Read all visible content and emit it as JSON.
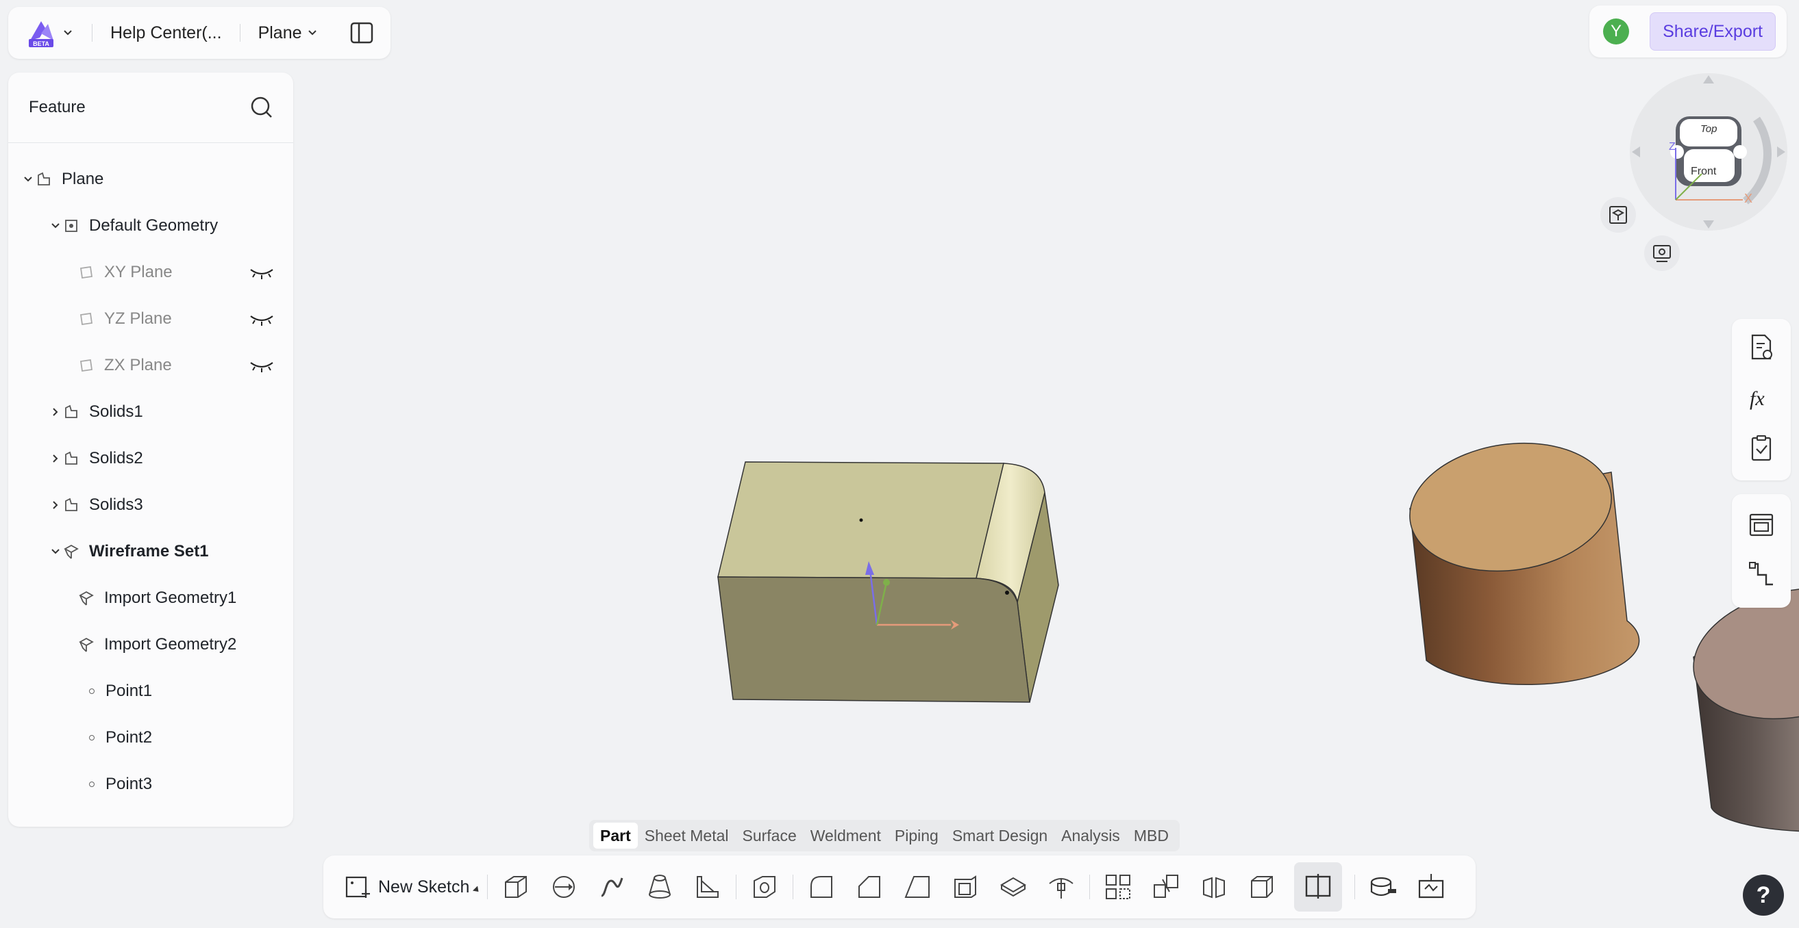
{
  "header": {
    "breadcrumb": "Help Center(...",
    "document": "Plane"
  },
  "share": {
    "avatar_letter": "Y",
    "label": "Share/Export"
  },
  "feature": {
    "title": "Feature",
    "tree": [
      {
        "label": "Plane"
      },
      {
        "label": "Default Geometry"
      },
      {
        "label": "XY Plane"
      },
      {
        "label": "YZ Plane"
      },
      {
        "label": "ZX Plane"
      },
      {
        "label": "Solids1"
      },
      {
        "label": "Solids2"
      },
      {
        "label": "Solids3"
      },
      {
        "label": "Wireframe Set1"
      },
      {
        "label": "Import Geometry1"
      },
      {
        "label": "Import Geometry2"
      },
      {
        "label": "Point1"
      },
      {
        "label": "Point2"
      },
      {
        "label": "Point3"
      }
    ]
  },
  "viewcube": {
    "top": "Top",
    "front": "Front",
    "axis_x": "X",
    "axis_z": "Z"
  },
  "mode_tabs": [
    "Part",
    "Sheet Metal",
    "Surface",
    "Weldment",
    "Piping",
    "Smart Design",
    "Analysis",
    "MBD"
  ],
  "toolbar": {
    "new_sketch": "New Sketch"
  },
  "help": "?",
  "colors": {
    "accent": "#5a3de0",
    "box_top": "#c9c69a",
    "box_front": "#8a8564",
    "cylinder_top": "#c9a06e"
  }
}
